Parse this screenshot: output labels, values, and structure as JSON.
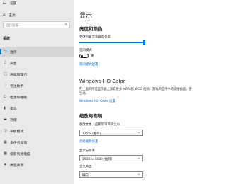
{
  "window": {
    "title": "设置"
  },
  "sidebar": {
    "home_label": "主页",
    "search_placeholder": "查找设置",
    "section_label": "系统",
    "items": [
      {
        "label": "显示",
        "icon": "monitor-icon",
        "active": true
      },
      {
        "label": "声音",
        "icon": "speaker-icon"
      },
      {
        "label": "通知和操作",
        "icon": "notification-icon"
      },
      {
        "label": "专注助手",
        "icon": "moon-icon"
      },
      {
        "label": "电源和睡眠",
        "icon": "power-icon"
      },
      {
        "label": "电池",
        "icon": "battery-icon"
      },
      {
        "label": "存储",
        "icon": "storage-icon"
      },
      {
        "label": "平板模式",
        "icon": "tablet-icon"
      },
      {
        "label": "多任务处理",
        "icon": "multitask-icon"
      },
      {
        "label": "投影到此电脑",
        "icon": "project-icon"
      },
      {
        "label": "体验共享",
        "icon": "share-icon"
      }
    ]
  },
  "main": {
    "title": "显示",
    "brightness": {
      "heading": "亮度和颜色",
      "slider_label": "更改内置显示器的亮度",
      "night_light_label": "夜间模式",
      "night_light_state": "关",
      "night_light_link": "夜间模式设置"
    },
    "hd_color": {
      "heading": "Windows HD Color",
      "description": "在上面的所选显示器上获取更多 HDR 和 WCG 视频、游戏和应用中的亮丽画面，更生动。",
      "link": "Windows HD Color 设置"
    },
    "scale_layout": {
      "heading": "缩放与布局",
      "scale_label": "更改文本、应用等项目的大小",
      "scale_value": "125% (推荐)",
      "advanced_link": "高级缩放设置",
      "resolution_label": "显示分辨率",
      "resolution_value": "1920 × 1080 (推荐)",
      "orientation_label": "显示方向",
      "orientation_value": "横向"
    }
  },
  "colors": {
    "accent": "#0078d7",
    "sidebar_bg": "#e9e9e9"
  }
}
